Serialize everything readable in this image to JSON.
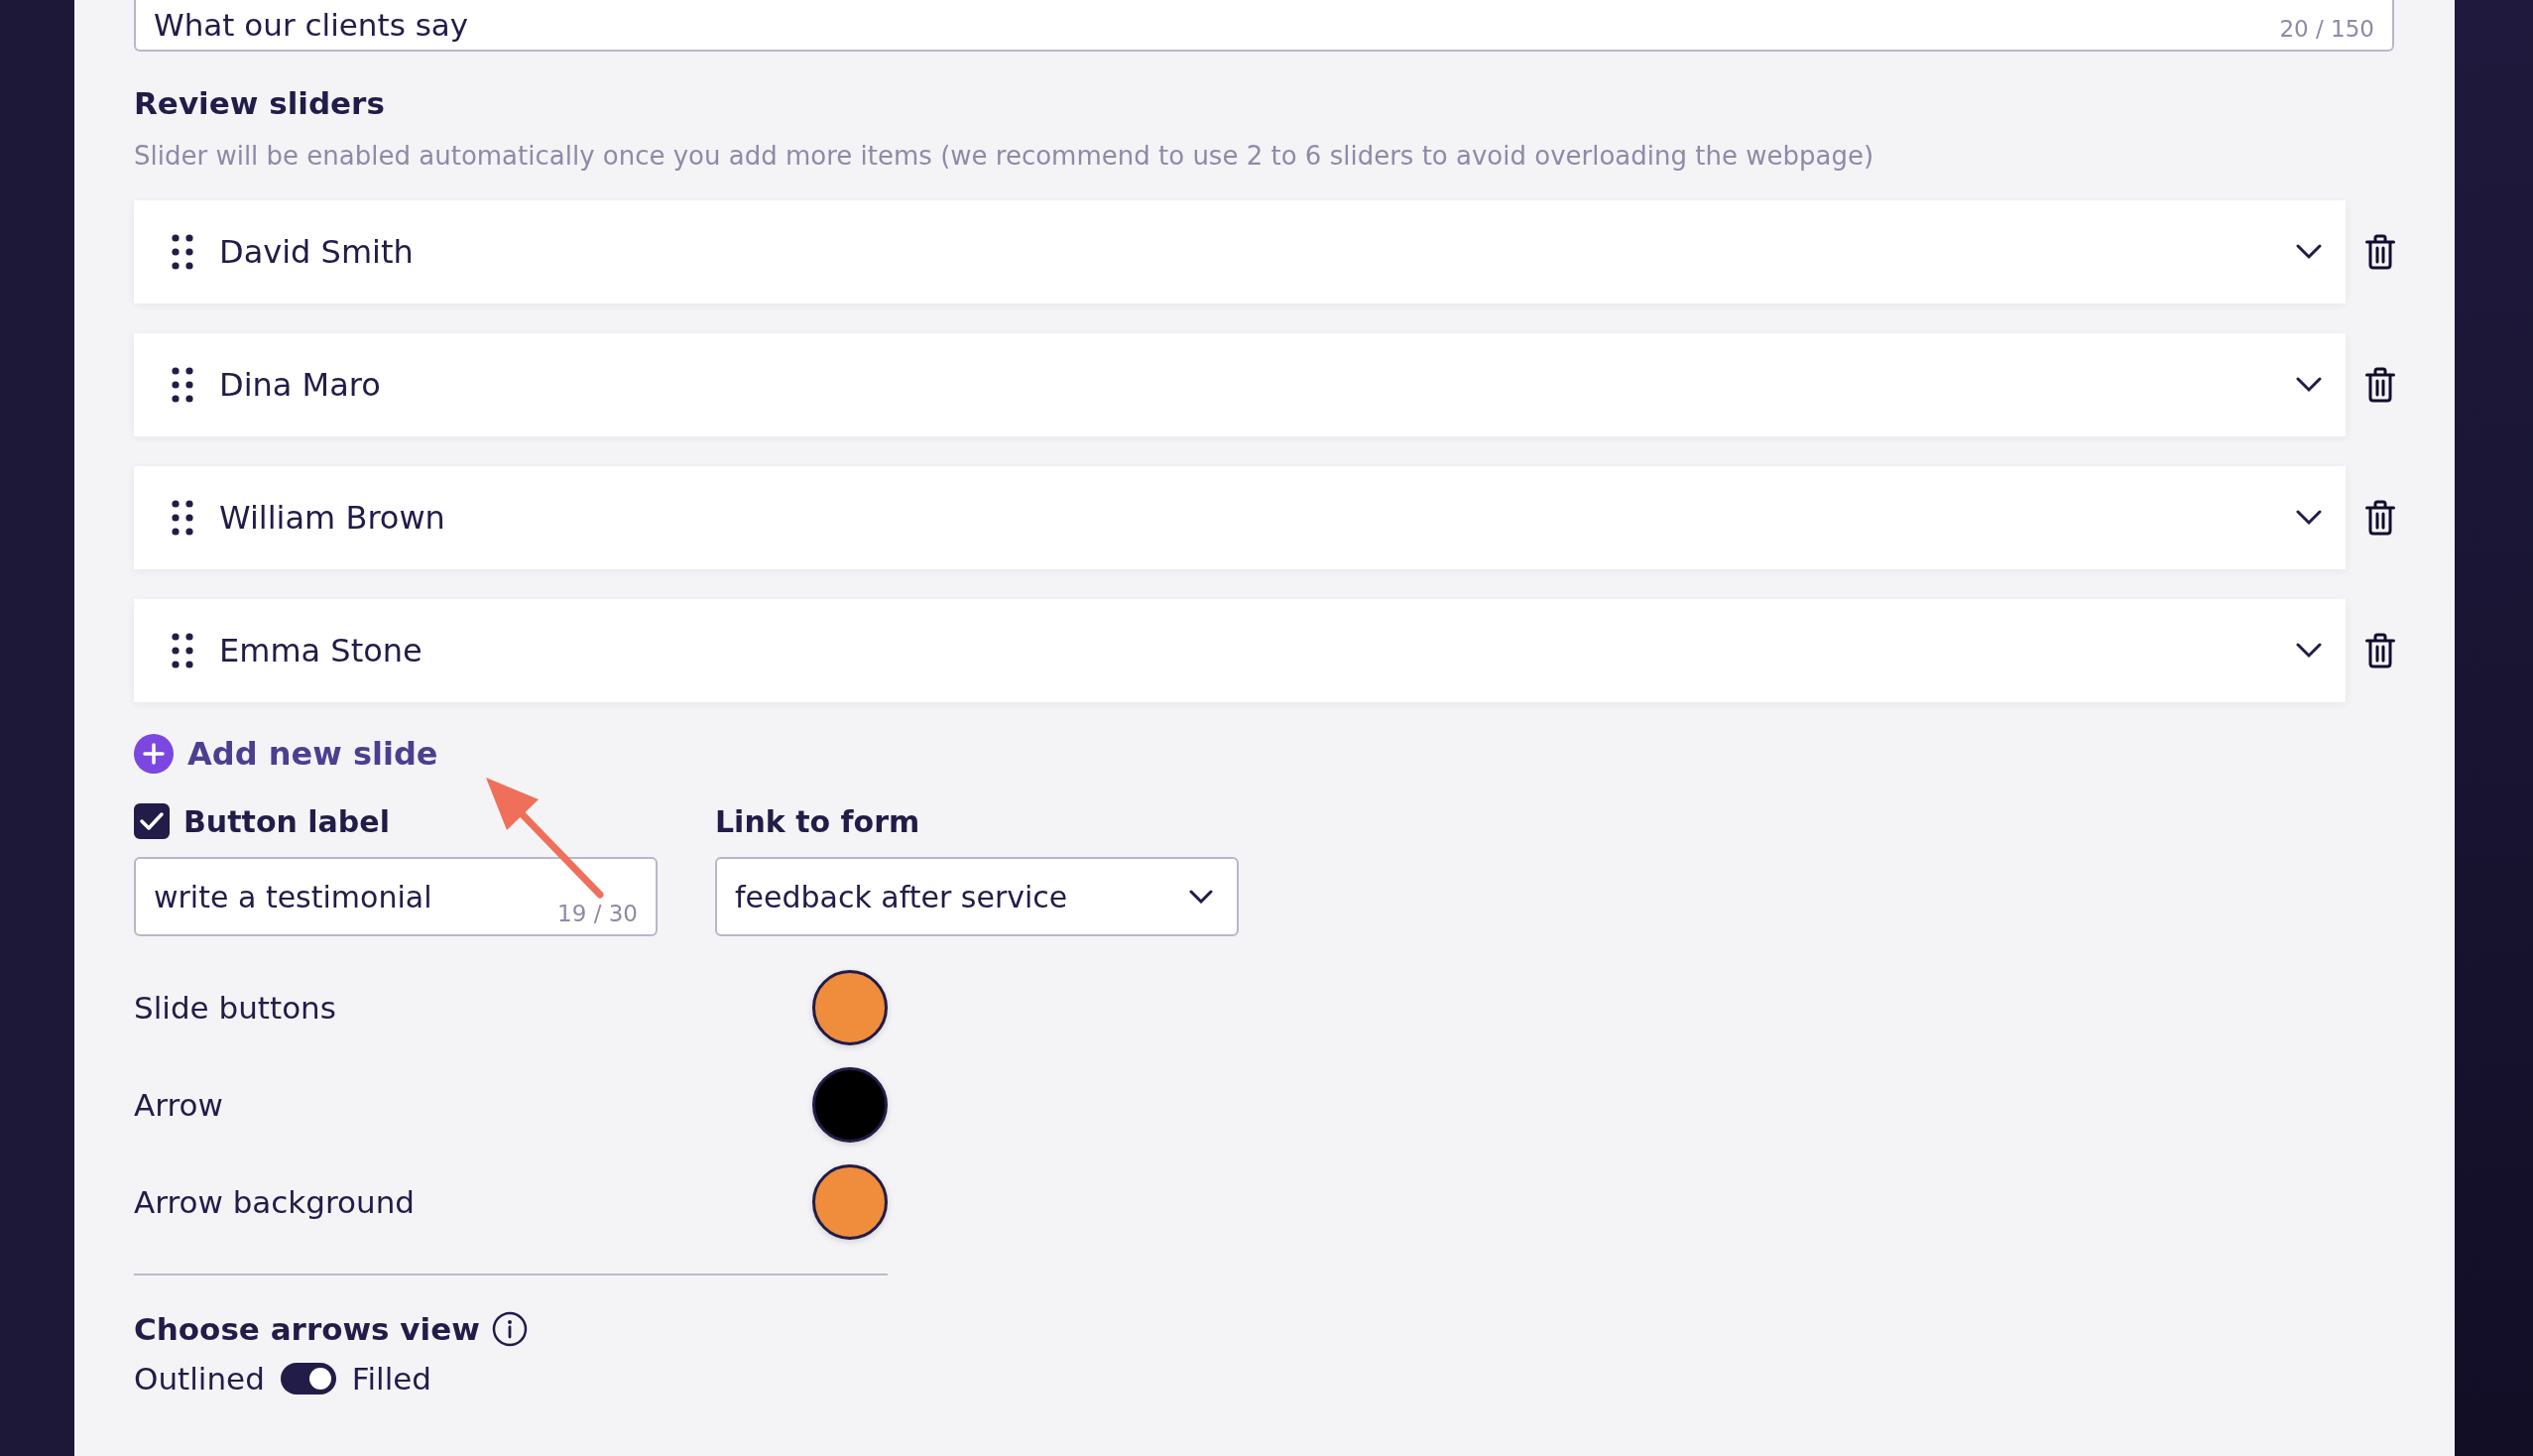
{
  "title_field": {
    "value": "What our clients say",
    "counter": "20 / 150"
  },
  "review_sliders": {
    "heading": "Review sliders",
    "description": "Slider will be enabled automatically once you add more items (we recommend to use 2 to 6 sliders to avoid overloading the webpage)",
    "items": [
      {
        "name": "David Smith",
        "expanded": false
      },
      {
        "name": "Dina Maro",
        "expanded": false
      },
      {
        "name": "William Brown",
        "expanded": false
      },
      {
        "name": "Emma Stone",
        "expanded": false
      }
    ],
    "add_button": "Add new slide"
  },
  "button_label": {
    "label": "Button label",
    "checked": true,
    "value": "write a testimonial",
    "counter": "19 / 30"
  },
  "link_to_form": {
    "label": "Link to form",
    "value": "feedback after service"
  },
  "colors": [
    {
      "label": "Slide buttons",
      "color": "#ef8d3d"
    },
    {
      "label": "Arrow",
      "color": "#000000"
    },
    {
      "label": "Arrow background",
      "color": "#ef8d3d"
    }
  ],
  "arrows_view": {
    "heading": "Choose arrows view",
    "left_label": "Outlined",
    "right_label": "Filled",
    "on": true
  }
}
